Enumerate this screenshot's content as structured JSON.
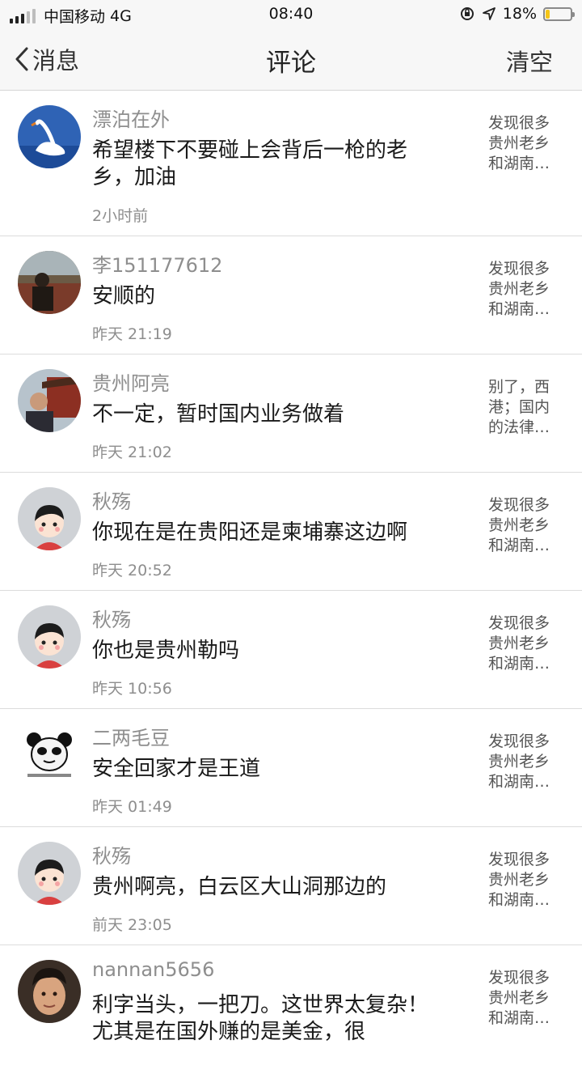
{
  "status_bar": {
    "carrier": "中国移动",
    "network": "4G",
    "time": "08:40",
    "battery_percent": "18%",
    "battery_level": 0.18
  },
  "nav": {
    "back_label": "消息",
    "title": "评论",
    "clear_label": "清空"
  },
  "comments": [
    {
      "name": "漂泊在外",
      "text": "希望楼下不要碰上会背后一枪的老乡，加油",
      "time": "2小时前",
      "preview": [
        "发现很多",
        "贵州老乡",
        "和湖南…"
      ],
      "avatar": "swan"
    },
    {
      "name": "李151177612",
      "text": "安顺的",
      "time": "昨天 21:19",
      "preview": [
        "发现很多",
        "贵州老乡",
        "和湖南…"
      ],
      "avatar": "photo-dark"
    },
    {
      "name": "贵州阿亮",
      "text": "不一定，暂时国内业务做着",
      "time": "昨天 21:02",
      "preview": [
        "别了，西",
        "港；国内",
        "的法律…"
      ],
      "avatar": "photo-temple"
    },
    {
      "name": "秋殇",
      "text": "你现在是在贵阳还是柬埔寨这边啊",
      "time": "昨天 20:52",
      "preview": [
        "发现很多",
        "贵州老乡",
        "和湖南…"
      ],
      "avatar": "cartoon"
    },
    {
      "name": "秋殇",
      "text": "你也是贵州勒吗",
      "time": "昨天 10:56",
      "preview": [
        "发现很多",
        "贵州老乡",
        "和湖南…"
      ],
      "avatar": "cartoon"
    },
    {
      "name": "二两毛豆",
      "text": "安全回家才是王道",
      "time": "昨天 01:49",
      "preview": [
        "发现很多",
        "贵州老乡",
        "和湖南…"
      ],
      "avatar": "panda"
    },
    {
      "name": "秋殇",
      "text": "贵州啊亮，白云区大山洞那边的",
      "time": "前天 23:05",
      "preview": [
        "发现很多",
        "贵州老乡",
        "和湖南…"
      ],
      "avatar": "cartoon"
    },
    {
      "name": "nannan5656",
      "text": "利字当头，一把刀。这世界太复杂！尤其是在国外赚的是美金，很",
      "time": "",
      "preview": [
        "发现很多",
        "贵州老乡",
        "和湖南…"
      ],
      "avatar": "photo-face"
    }
  ]
}
